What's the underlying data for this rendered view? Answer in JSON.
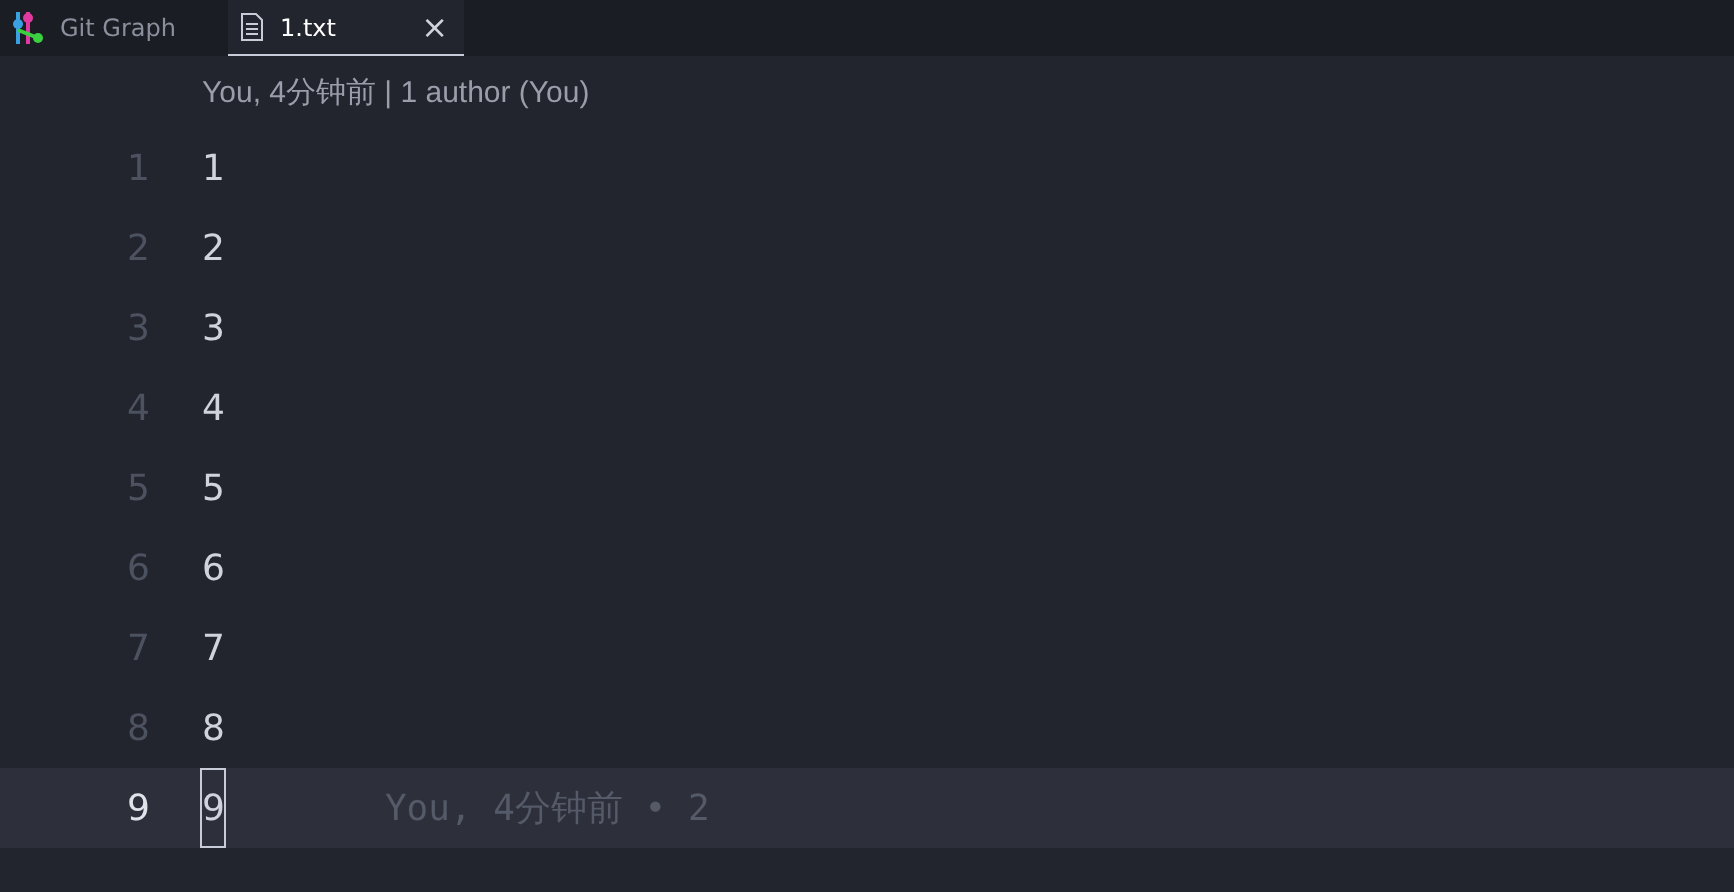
{
  "tabs": [
    {
      "label": "Git Graph",
      "kind": "graph",
      "selected": false,
      "closable": false
    },
    {
      "label": "1.txt",
      "kind": "file",
      "selected": true,
      "closable": true
    }
  ],
  "close_glyph": "×",
  "codelens": "You, 4分钟前 | 1 author (You)",
  "lines": [
    {
      "number": "1",
      "text": "1",
      "current": false
    },
    {
      "number": "2",
      "text": "2",
      "current": false
    },
    {
      "number": "3",
      "text": "3",
      "current": false
    },
    {
      "number": "4",
      "text": "4",
      "current": false
    },
    {
      "number": "5",
      "text": "5",
      "current": false
    },
    {
      "number": "6",
      "text": "6",
      "current": false
    },
    {
      "number": "7",
      "text": "7",
      "current": false
    },
    {
      "number": "8",
      "text": "8",
      "current": false
    },
    {
      "number": "9",
      "text": "9",
      "current": true
    }
  ],
  "blame": "You, 4分钟前 • 2"
}
